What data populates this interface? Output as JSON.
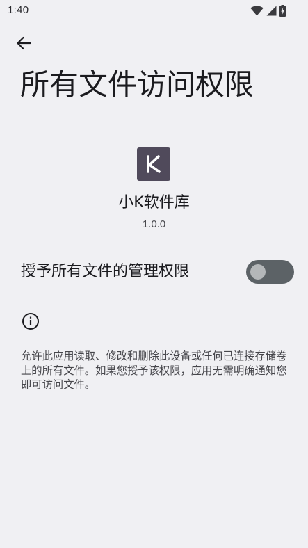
{
  "status_bar": {
    "time": "1:40",
    "icons": [
      "wifi-icon",
      "cell-signal-icon",
      "battery-charging-icon"
    ]
  },
  "toolbar": {
    "back_icon": "arrow-back-icon"
  },
  "page": {
    "title": "所有文件访问权限"
  },
  "app": {
    "icon": "app-k-logo",
    "icon_letter": "K",
    "name": "小K软件库",
    "version": "1.0.0"
  },
  "permission": {
    "label": "授予所有文件的管理权限",
    "enabled": false
  },
  "info": {
    "icon": "info-icon",
    "description": "允许此应用读取、修改和删除此设备或任何已连接存储卷上的所有文件。如果您授予该权限，应用无需明确通知您即可访问文件。"
  },
  "colors": {
    "background": "#f0f0f3",
    "app_icon_bg": "#504a5b",
    "toggle_track_off": "#5c6266",
    "toggle_thumb_off": "#b4b7b9",
    "primary_text": "#1b1b1f",
    "secondary_text": "#46464b"
  }
}
